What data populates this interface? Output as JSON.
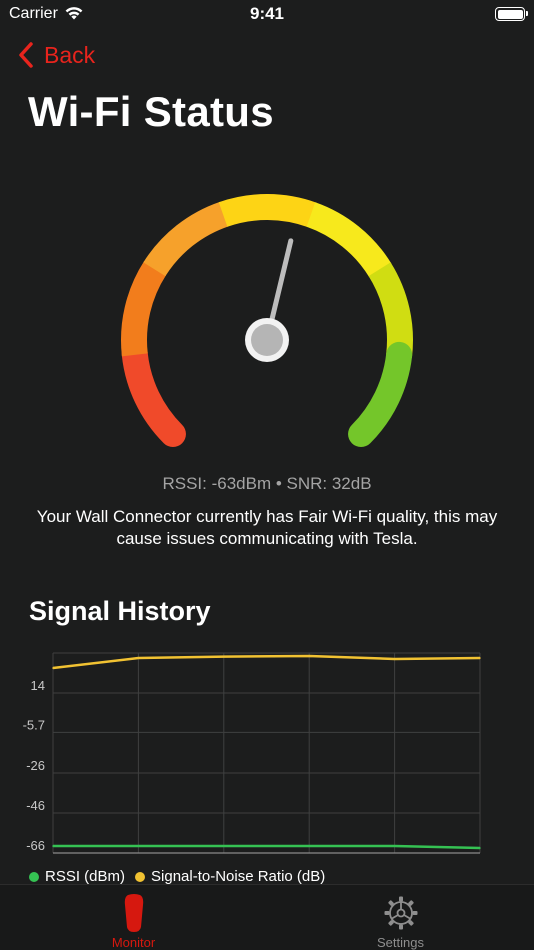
{
  "status_bar": {
    "carrier": "Carrier",
    "time": "9:41",
    "wifi_icon": "wifi-icon",
    "battery_icon": "battery-icon"
  },
  "nav": {
    "back_label": "Back",
    "back_icon": "chevron-left-icon"
  },
  "page": {
    "title": "Wi-Fi Status"
  },
  "gauge": {
    "needle_fraction": 0.55,
    "colors": [
      "#f04a2a",
      "#f27d1c",
      "#f6a12b",
      "#fdd415",
      "#f7e91c",
      "#d0dd12",
      "#74c62a"
    ]
  },
  "status": {
    "stats": "RSSI: -63dBm • SNR: 32dB",
    "message": "Your Wall Connector currently has Fair Wi-Fi quality, this may cause issues communicating with Tesla."
  },
  "history": {
    "title": "Signal History"
  },
  "chart_data": {
    "type": "line",
    "x": [
      0,
      1,
      2,
      3,
      4,
      5
    ],
    "ylim": [
      -66,
      34
    ],
    "ytick_labels": [
      "14",
      "-5.7",
      "-26",
      "-46",
      "-66"
    ],
    "ytick_values": [
      14,
      -5.7,
      -26,
      -46,
      -66
    ],
    "grid": true,
    "legend_position": "bottom-left",
    "series": [
      {
        "name": "RSSI (dBm)",
        "color": "#35c253",
        "values": [
          -62.5,
          -62.5,
          -62.5,
          -62.5,
          -62.5,
          -63.5
        ]
      },
      {
        "name": "Signal-to-Noise Ratio (dB)",
        "color": "#f1c232",
        "values": [
          26.5,
          31.5,
          32.2,
          32.5,
          31,
          31.5
        ]
      }
    ]
  },
  "tabs": [
    {
      "label": "Monitor",
      "icon": "wall-connector-icon",
      "color": "#d6180f"
    },
    {
      "label": "Settings",
      "icon": "gear-icon",
      "color": "#8e8e8e"
    }
  ]
}
